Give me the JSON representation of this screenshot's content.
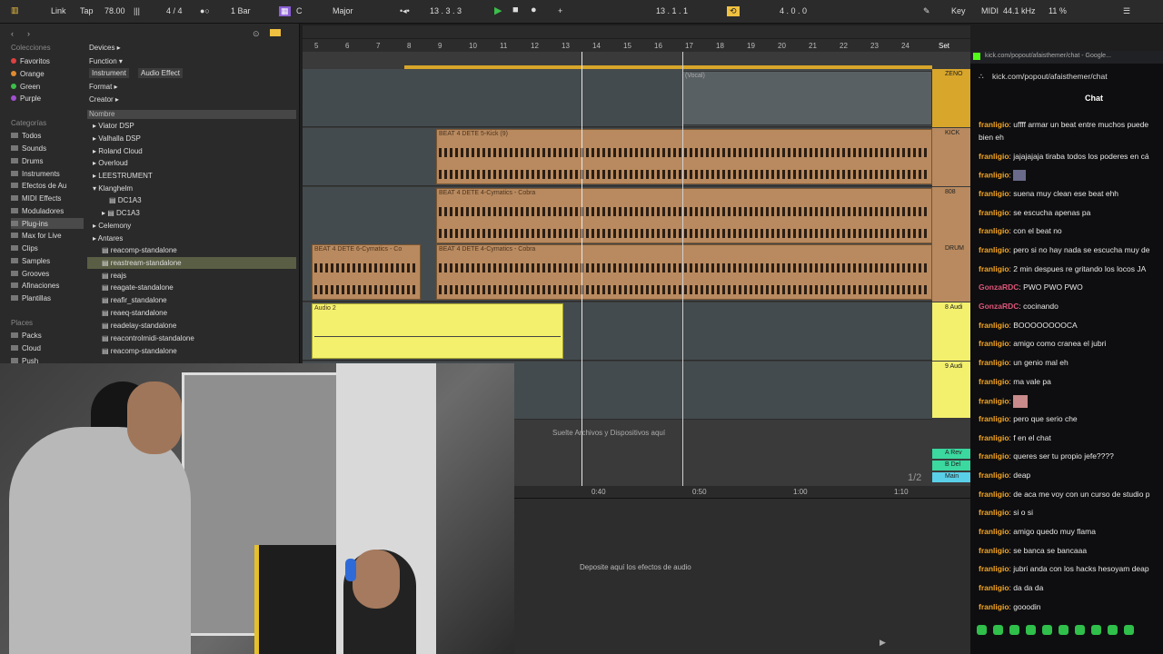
{
  "topbar": {
    "link": "Link",
    "tap": "Tap",
    "tempo": "78.00",
    "signature": "4 / 4",
    "quantize": "1 Bar",
    "key": "C",
    "scale": "Major",
    "position": "13 .  3 .  3",
    "loop_start": "13 .  1 .  1",
    "loop_length": "4 .  0 .  0",
    "key_label": "Key",
    "midi_label": "MIDI",
    "sample_rate": "44.1 kHz",
    "cpu": "11 %"
  },
  "browser": {
    "collections_header": "Colecciones",
    "collections": [
      {
        "label": "Favoritos",
        "color": "#e04040"
      },
      {
        "label": "Orange",
        "color": "#e08a30"
      },
      {
        "label": "Green",
        "color": "#3bbf4a"
      },
      {
        "label": "Purple",
        "color": "#a050d0"
      }
    ],
    "categories_header": "Categorías",
    "categories": [
      "Todos",
      "Sounds",
      "Drums",
      "Instruments",
      "Efectos de Au",
      "MIDI Effects",
      "Moduladores",
      "Plug-ins",
      "Max for Live",
      "Clips",
      "Samples",
      "Grooves",
      "Afinaciones",
      "Plantillas"
    ],
    "places_header": "Places",
    "places": [
      "Packs",
      "Cloud",
      "Push"
    ],
    "filters": {
      "devices": "Devices ▸",
      "function": "Function ▾",
      "instrument": "Instrument",
      "audio_effect": "Audio Effect",
      "format": "Format ▸",
      "creator": "Creator ▸"
    },
    "column_header": "Nombre",
    "tree": [
      "Viator DSP",
      "Valhalla DSP",
      "Roland Cloud",
      "Overloud",
      "LEESTRUMENT",
      "Klanghelm",
      "DC1A3",
      "DC1A3",
      "Celemony",
      "Antares",
      "reacomp-standalone",
      "reastream-standalone",
      "reajs",
      "reagate-standalone",
      "reafir_standalone",
      "reaeq-standalone",
      "readelay-standalone",
      "reacontrolmidi-standalone",
      "reacomp-standalone"
    ]
  },
  "arrangement": {
    "ruler": [
      "5",
      "6",
      "7",
      "8",
      "9",
      "10",
      "11",
      "12",
      "13",
      "14",
      "15",
      "16",
      "17",
      "18",
      "19",
      "20",
      "21",
      "22",
      "23",
      "24"
    ],
    "set_label": "Set",
    "vocal_clip": "(Vocal)",
    "kick_clip": "BEAT 4 DETE 5-Kick (9)",
    "cymatics_clip": "BEAT 4 DETE 4-Cymatics - Cobra",
    "drum_clip": "BEAT 4 DETE 6-Cymatics - Co",
    "audio2_clip": "Audio 2",
    "drop_hint": "Suelte Archivos y Dispositivos aquí",
    "tracks": [
      "ZENO",
      "KICK",
      "808",
      "DRUM",
      "8 Audi",
      "9 Audi"
    ],
    "returns": [
      "A Rev",
      "B Del",
      "Main"
    ],
    "time_marks": [
      "0:40",
      "0:50",
      "1:00",
      "1:10"
    ],
    "page": "1/2"
  },
  "bottom": {
    "hint": "Deposite aquí los efectos de audio"
  },
  "chat": {
    "url": "kick.com/popout/afaisthemer/chat - Google...",
    "address": "kick.com/popout/afaisthemer/chat",
    "title": "Chat",
    "messages": [
      {
        "user": "franligio",
        "text": ": uffff armar un beat entre muchos puede"
      },
      {
        "user": "",
        "text": "bien eh"
      },
      {
        "user": "franligio",
        "text": ": jajajajaja tiraba todos los poderes en cá"
      },
      {
        "user": "franligio",
        "text": ":"
      },
      {
        "user": "franligio",
        "text": ": suena muy clean ese beat ehh"
      },
      {
        "user": "franligio",
        "text": ": se escucha apenas pa"
      },
      {
        "user": "franligio",
        "text": ": con el beat no"
      },
      {
        "user": "franligio",
        "text": ": pero si no hay nada se escucha muy de"
      },
      {
        "user": "franligio",
        "text": ": 2 min despues re gritando los locos JA"
      },
      {
        "user": "GonzaRDC",
        "text": ": PWO PWO PWO"
      },
      {
        "user": "GonzaRDC",
        "text": ": cocinando"
      },
      {
        "user": "franligio",
        "text": ": BOOOOOOOOCA"
      },
      {
        "user": "franligio",
        "text": ": amigo como cranea el jubri"
      },
      {
        "user": "franligio",
        "text": ": un genio mal eh"
      },
      {
        "user": "franligio",
        "text": ": ma vale pa"
      },
      {
        "user": "franligio",
        "text": ":"
      },
      {
        "user": "franligio",
        "text": ": pero que serio che"
      },
      {
        "user": "franligio",
        "text": ": f en el chat"
      },
      {
        "user": "franligio",
        "text": ": queres ser tu propio jefe????"
      },
      {
        "user": "franligio",
        "text": ": deap"
      },
      {
        "user": "franligio",
        "text": ": de aca me voy con un curso de studio p"
      },
      {
        "user": "franligio",
        "text": ": si o si"
      },
      {
        "user": "franligio",
        "text": ": amigo quedo muy flama"
      },
      {
        "user": "franligio",
        "text": ": se banca se bancaaa"
      },
      {
        "user": "franligio",
        "text": ": jubri anda con los hacks hesoyam deap"
      },
      {
        "user": "franligio",
        "text": ": da da da"
      },
      {
        "user": "franligio",
        "text": ": gooodin"
      }
    ]
  },
  "colors": {
    "franligio": "#f5a623",
    "GonzaRDC": "#e0567a",
    "accent": "#f0c040",
    "clip": "#b98a5f",
    "yellow_clip": "#f3f06e"
  }
}
